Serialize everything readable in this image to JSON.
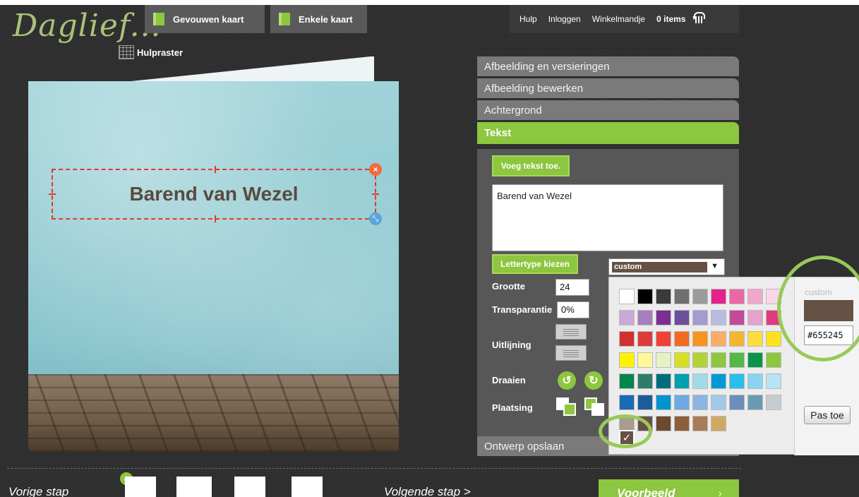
{
  "logo": {
    "text": "Daglief..."
  },
  "top_tabs": [
    {
      "label": "Gevouwen kaart"
    },
    {
      "label": "Enkele kaart"
    }
  ],
  "grid_toggle": {
    "label": "Hulpraster"
  },
  "topnav": {
    "help": "Hulp",
    "login": "Inloggen",
    "cart_label": "Winkelmandje",
    "cart_count": "0 items"
  },
  "card": {
    "text": "Barend van Wezel",
    "delete_glyph": "×",
    "resize_glyph": "⤡"
  },
  "accordion": [
    {
      "label": "Afbeelding en versieringen"
    },
    {
      "label": "Afbeelding bewerken"
    },
    {
      "label": "Achtergrond"
    },
    {
      "label": "Tekst"
    }
  ],
  "text_panel": {
    "add_text_label": "Voeg tekst toe.",
    "text_value": "Barend van Wezel",
    "font_button_label": "Lettertype kiezen",
    "color_select_value": "custom",
    "color_select_arrow": "▼",
    "size_label": "Grootte",
    "size_value": "24",
    "transparency_label": "Transparantie",
    "transparency_value": "0%",
    "alignment_label": "Uitlijning",
    "rotate_label": "Draaien",
    "rotate_left_glyph": "↺",
    "rotate_right_glyph": "↻",
    "placement_label": "Plaatsing"
  },
  "color_picker": {
    "custom_label": "custom",
    "hex_value": "#655245",
    "selected_color": "#655245",
    "apply_label": "Pas toe",
    "check_glyph": "✓",
    "swatches": [
      [
        "#ffffff",
        "#000000",
        "#3a3a3a",
        "#6f6f6f",
        "#9b9b9b",
        "#e4208c",
        "#ec67a9",
        "#f3a6cc",
        "#fad7e8"
      ],
      [
        "#c9a9d6",
        "#a77ebf",
        "#7b3091",
        "#6a4f9a",
        "#a49bd0",
        "#b8bce0",
        "#c44a9a",
        "#e5a3cc",
        "#e23a7e"
      ],
      [
        "#d22f2f",
        "#dd3b3b",
        "#ef4136",
        "#f26a21",
        "#f7941d",
        "#fbad68",
        "#f2b632",
        "#fddc3d",
        "#ffe21f"
      ],
      [
        "#fff200",
        "#fff799",
        "#e6f2c2",
        "#d7df23",
        "#b2d235",
        "#8dc63f",
        "#54b848",
        "#0a9447",
        "#8dc63f"
      ],
      [
        "#00854a",
        "#2e7d6a",
        "#006d7d",
        "#00a0b0",
        "#a2dbe8",
        "#0099d6",
        "#27c0ea",
        "#8ad3f2",
        "#b8e2f5"
      ],
      [
        "#1a6bb5",
        "#1c5d99",
        "#0093d0",
        "#6eaadf",
        "#8bb4e0",
        "#a2c8e8",
        "#6c8ebf",
        "#6a9ab3",
        "#c7ccd0"
      ],
      [
        "#a89c8f",
        "#655245",
        "#6b4a2f",
        "#8b5e3c",
        "#a97c58",
        "#d0a865"
      ]
    ]
  },
  "save_design": {
    "label": "Ontwerp opslaan"
  },
  "bottom": {
    "prev": "Vorige stap",
    "next": "Volgende stap >",
    "preview": "Voorbeeld",
    "preview_chevron": "›",
    "thumb_check_glyph": "✓"
  }
}
